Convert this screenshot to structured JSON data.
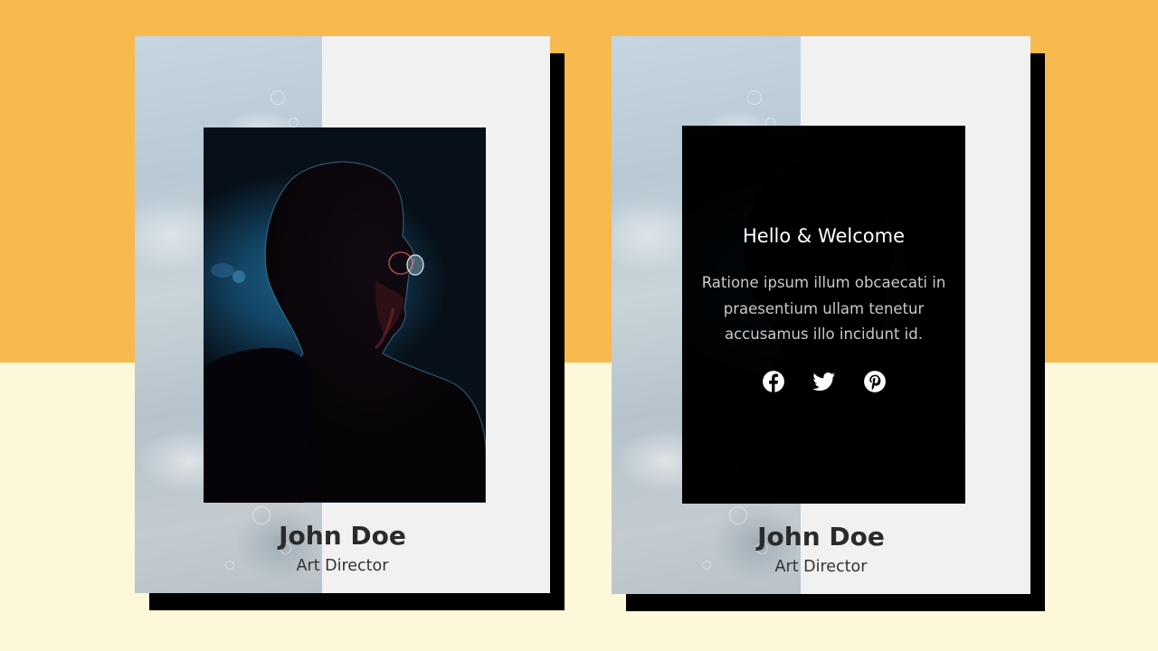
{
  "colors": {
    "background_top": "#f8b94e",
    "background_bottom": "#fdf8d9",
    "card": "#f1f1f1",
    "shadow": "#000000"
  },
  "cards": [
    {
      "name": "John Doe",
      "role": "Art Director",
      "state": "default"
    },
    {
      "name": "John Doe",
      "role": "Art Director",
      "state": "hover",
      "overlay": {
        "title": "Hello & Welcome",
        "text": "Ratione ipsum illum obcaecati in praesentium ullam tenetur accusamus illo incidunt id.",
        "social_icons": [
          "facebook-icon",
          "twitter-icon",
          "pinterest-icon"
        ]
      }
    }
  ]
}
